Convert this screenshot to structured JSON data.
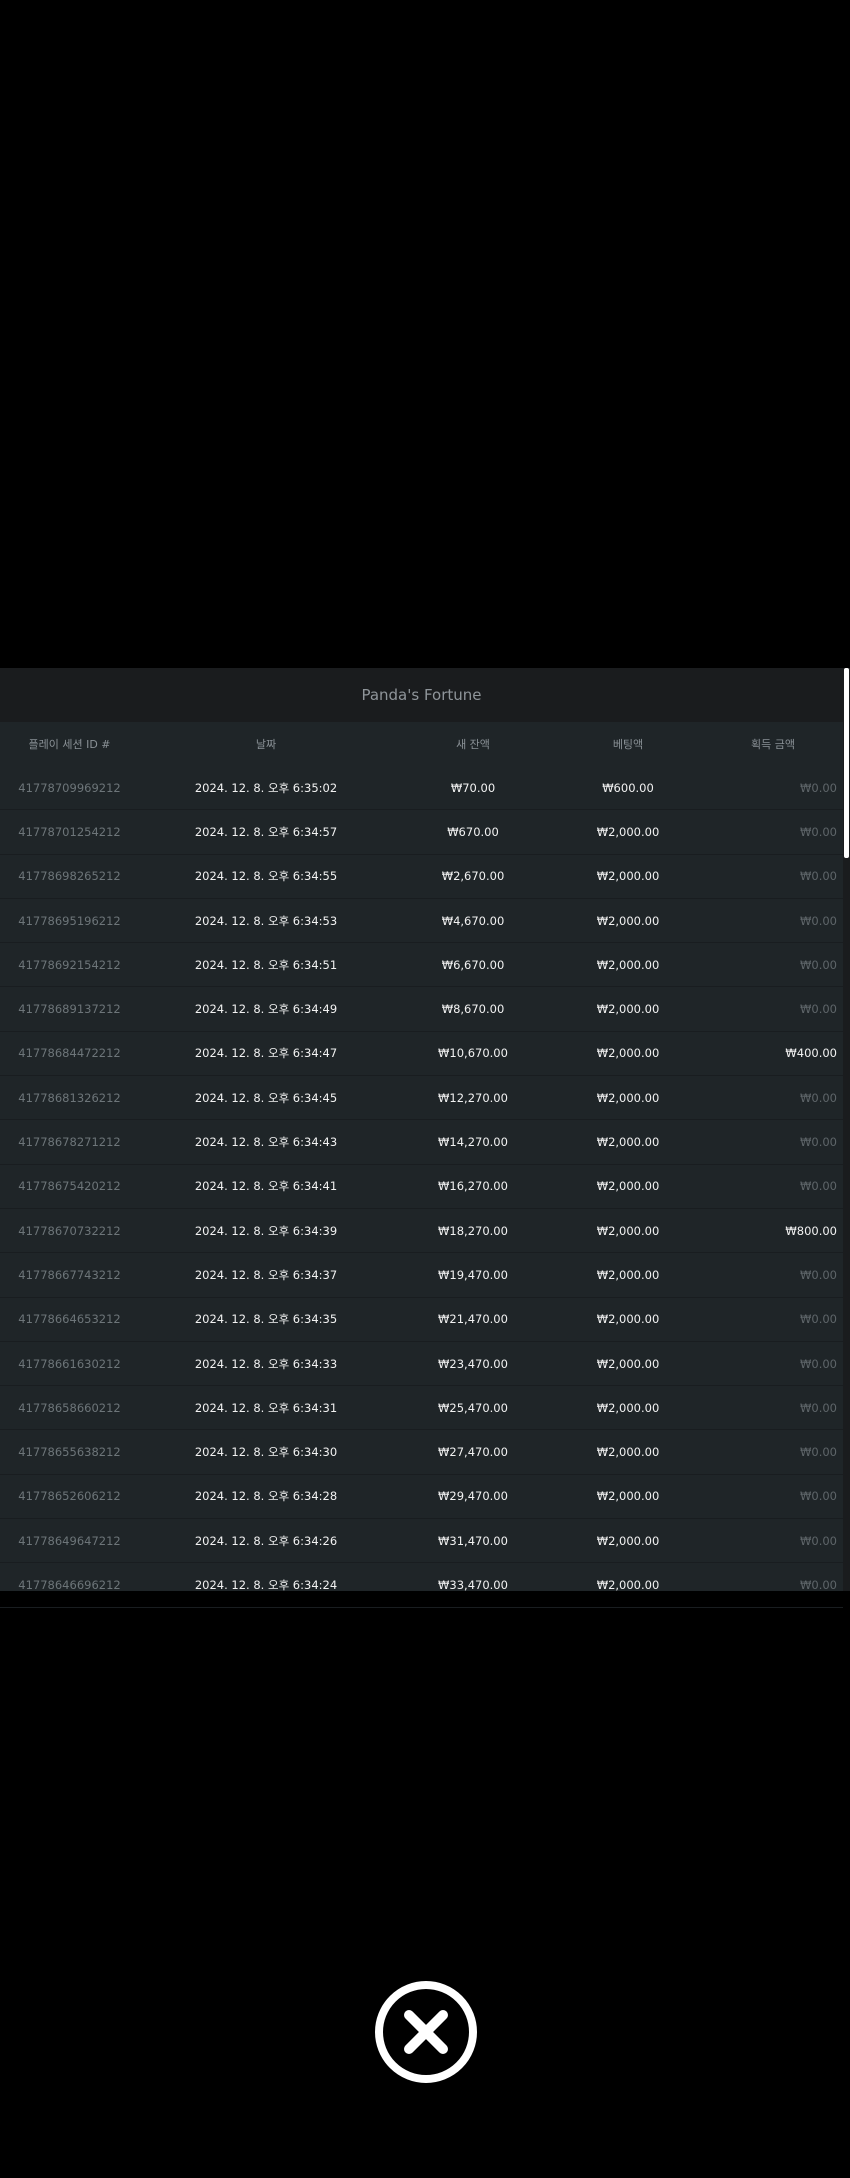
{
  "title": "Panda's Fortune",
  "columns": [
    "플레이 세션 ID #",
    "날짜",
    "새 잔액",
    "베팅액",
    "획득 금액"
  ],
  "rows": [
    {
      "id": "41778709969212",
      "date": "2024. 12. 8. 오후 6:35:02",
      "balance": "₩70.00",
      "bet": "₩600.00",
      "win": "₩0.00"
    },
    {
      "id": "41778701254212",
      "date": "2024. 12. 8. 오후 6:34:57",
      "balance": "₩670.00",
      "bet": "₩2,000.00",
      "win": "₩0.00"
    },
    {
      "id": "41778698265212",
      "date": "2024. 12. 8. 오후 6:34:55",
      "balance": "₩2,670.00",
      "bet": "₩2,000.00",
      "win": "₩0.00"
    },
    {
      "id": "41778695196212",
      "date": "2024. 12. 8. 오후 6:34:53",
      "balance": "₩4,670.00",
      "bet": "₩2,000.00",
      "win": "₩0.00"
    },
    {
      "id": "41778692154212",
      "date": "2024. 12. 8. 오후 6:34:51",
      "balance": "₩6,670.00",
      "bet": "₩2,000.00",
      "win": "₩0.00"
    },
    {
      "id": "41778689137212",
      "date": "2024. 12. 8. 오후 6:34:49",
      "balance": "₩8,670.00",
      "bet": "₩2,000.00",
      "win": "₩0.00"
    },
    {
      "id": "41778684472212",
      "date": "2024. 12. 8. 오후 6:34:47",
      "balance": "₩10,670.00",
      "bet": "₩2,000.00",
      "win": "₩400.00"
    },
    {
      "id": "41778681326212",
      "date": "2024. 12. 8. 오후 6:34:45",
      "balance": "₩12,270.00",
      "bet": "₩2,000.00",
      "win": "₩0.00"
    },
    {
      "id": "41778678271212",
      "date": "2024. 12. 8. 오후 6:34:43",
      "balance": "₩14,270.00",
      "bet": "₩2,000.00",
      "win": "₩0.00"
    },
    {
      "id": "41778675420212",
      "date": "2024. 12. 8. 오후 6:34:41",
      "balance": "₩16,270.00",
      "bet": "₩2,000.00",
      "win": "₩0.00"
    },
    {
      "id": "41778670732212",
      "date": "2024. 12. 8. 오후 6:34:39",
      "balance": "₩18,270.00",
      "bet": "₩2,000.00",
      "win": "₩800.00"
    },
    {
      "id": "41778667743212",
      "date": "2024. 12. 8. 오후 6:34:37",
      "balance": "₩19,470.00",
      "bet": "₩2,000.00",
      "win": "₩0.00"
    },
    {
      "id": "41778664653212",
      "date": "2024. 12. 8. 오후 6:34:35",
      "balance": "₩21,470.00",
      "bet": "₩2,000.00",
      "win": "₩0.00"
    },
    {
      "id": "41778661630212",
      "date": "2024. 12. 8. 오후 6:34:33",
      "balance": "₩23,470.00",
      "bet": "₩2,000.00",
      "win": "₩0.00"
    },
    {
      "id": "41778658660212",
      "date": "2024. 12. 8. 오후 6:34:31",
      "balance": "₩25,470.00",
      "bet": "₩2,000.00",
      "win": "₩0.00"
    },
    {
      "id": "41778655638212",
      "date": "2024. 12. 8. 오후 6:34:30",
      "balance": "₩27,470.00",
      "bet": "₩2,000.00",
      "win": "₩0.00"
    },
    {
      "id": "41778652606212",
      "date": "2024. 12. 8. 오후 6:34:28",
      "balance": "₩29,470.00",
      "bet": "₩2,000.00",
      "win": "₩0.00"
    },
    {
      "id": "41778649647212",
      "date": "2024. 12. 8. 오후 6:34:26",
      "balance": "₩31,470.00",
      "bet": "₩2,000.00",
      "win": "₩0.00"
    },
    {
      "id": "41778646696212",
      "date": "2024. 12. 8. 오후 6:34:24",
      "balance": "₩33,470.00",
      "bet": "₩2,000.00",
      "win": "₩0.00"
    }
  ],
  "close_icon": "close-circle-icon"
}
